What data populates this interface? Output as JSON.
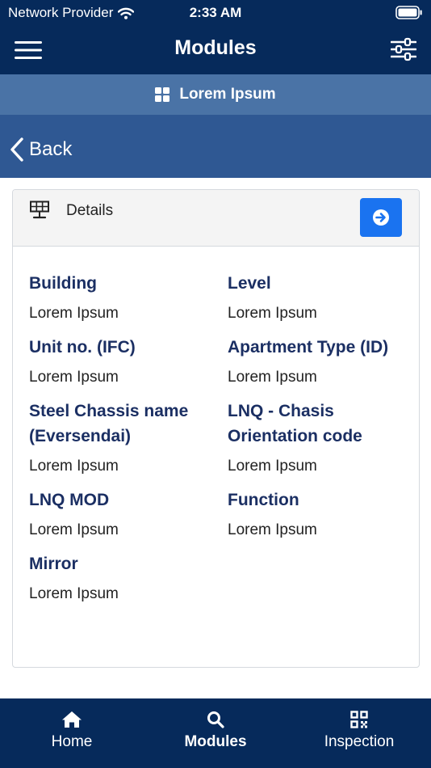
{
  "status_bar": {
    "carrier": "Network Provider",
    "time": "2:33 AM"
  },
  "nav": {
    "title": "Modules"
  },
  "sub_header": {
    "title": "Lorem Ipsum"
  },
  "back": {
    "label": "Back"
  },
  "card": {
    "title": "Details",
    "fields": [
      {
        "label": "Building",
        "value": "Lorem Ipsum"
      },
      {
        "label": "Level",
        "value": "Lorem Ipsum"
      },
      {
        "label": "Unit no. (IFC)",
        "value": "Lorem Ipsum"
      },
      {
        "label": "Apartment Type (ID)",
        "value": "Lorem Ipsum"
      },
      {
        "label": "Steel Chassis name (Eversendai)",
        "value": "Lorem Ipsum"
      },
      {
        "label": "LNQ - Chasis Orientation code",
        "value": "Lorem Ipsum"
      },
      {
        "label": "LNQ MOD",
        "value": "Lorem Ipsum"
      },
      {
        "label": "Function",
        "value": "Lorem Ipsum"
      },
      {
        "label": "Mirror",
        "value": "Lorem Ipsum"
      }
    ]
  },
  "tabs": [
    {
      "label": "Home",
      "icon": "home-icon"
    },
    {
      "label": "Modules",
      "icon": "search-icon"
    },
    {
      "label": "Inspection",
      "icon": "qr-code-icon"
    }
  ],
  "colors": {
    "nav": "#062a5b",
    "sub_header": "#4a73a6",
    "back_bar": "#2f5893",
    "accent_button": "#1a73f0",
    "label_text": "#1b2f63"
  }
}
